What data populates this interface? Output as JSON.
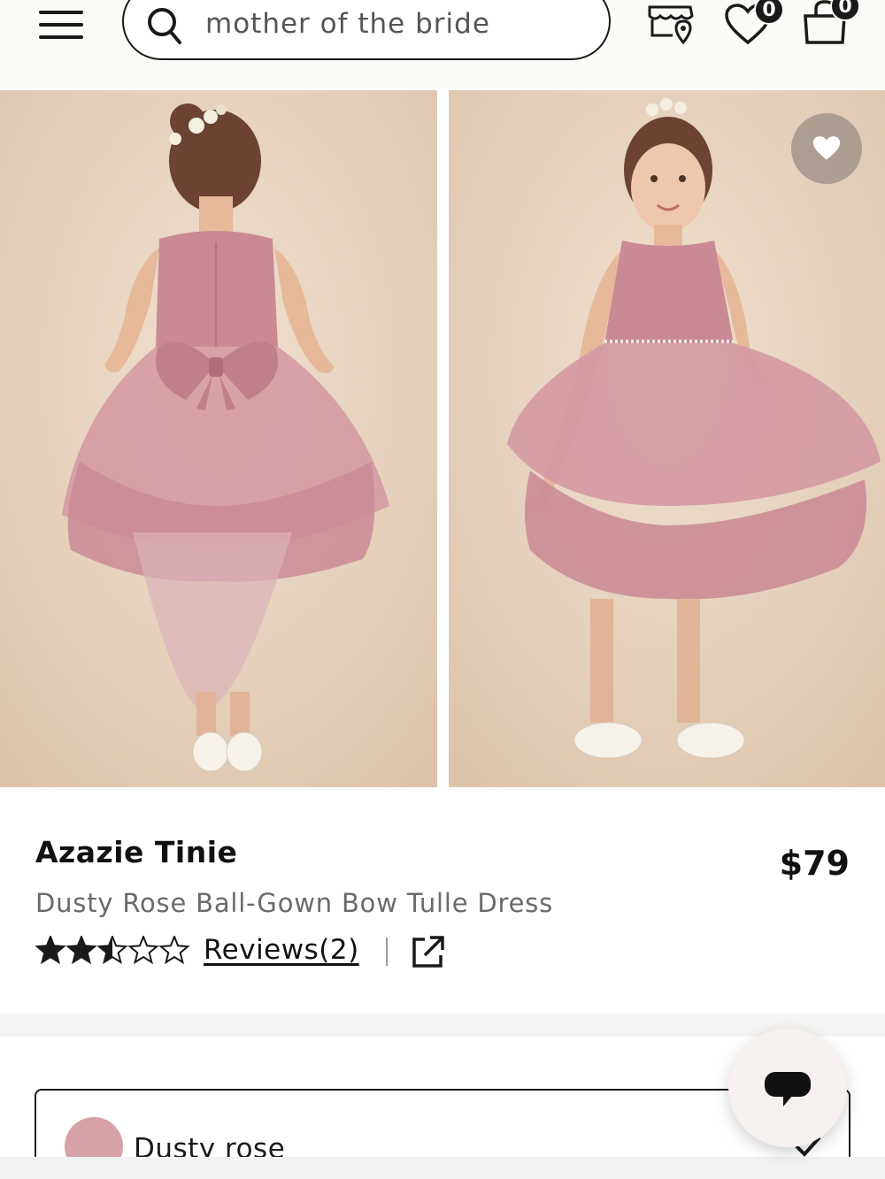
{
  "header": {
    "menu_icon": "hamburger-menu-icon",
    "search": {
      "value": "mother of the bride",
      "icon": "search-icon"
    },
    "store_locator_icon": "store-location-icon",
    "wishlist": {
      "icon": "heart-icon",
      "count": "0"
    },
    "cart": {
      "icon": "shopping-bag-icon",
      "count": "0"
    }
  },
  "gallery": {
    "images": [
      {
        "alt": "Back view of girl in dusty rose tulle dress with bow"
      },
      {
        "alt": "Front view of girl in dusty rose tulle dress"
      }
    ],
    "favorite_icon": "heart-icon"
  },
  "product": {
    "brand": "Azazie Tinie",
    "name": "Dusty Rose Ball-Gown Bow Tulle Dress",
    "price": "$79",
    "rating": 2.5,
    "rating_max": 5,
    "reviews_label": "Reviews(2)",
    "share_icon": "external-link-icon"
  },
  "color_option": {
    "label": "Dusty rose",
    "swatch_color": "#d7a1a8",
    "check_icon": "checkmark-icon"
  },
  "chat": {
    "icon": "chat-bubble-icon"
  },
  "colors": {
    "text": "#1a1a1a",
    "muted": "#6a6a6a",
    "header_bg": "#fbfaf6",
    "dress": "#c98a95"
  }
}
